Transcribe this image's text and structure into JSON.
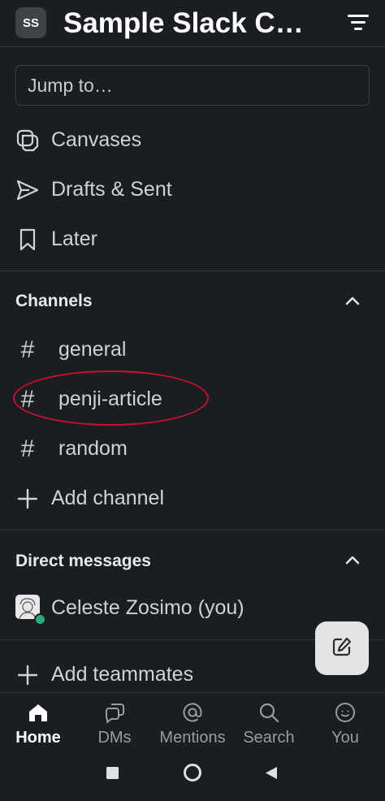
{
  "header": {
    "workspace_initials": "SS",
    "workspace_name": "Sample Slack C…"
  },
  "jump": {
    "placeholder": "Jump to…"
  },
  "shortcuts": [
    {
      "label": "Canvases",
      "icon": "canvases-icon"
    },
    {
      "label": "Drafts & Sent",
      "icon": "send-icon"
    },
    {
      "label": "Later",
      "icon": "bookmark-icon"
    }
  ],
  "channels": {
    "title": "Channels",
    "items": [
      {
        "name": "general"
      },
      {
        "name": "penji-article"
      },
      {
        "name": "random"
      }
    ],
    "add_label": "Add channel"
  },
  "direct_messages": {
    "title": "Direct messages",
    "items": [
      {
        "name": "Celeste Zosimo (you)",
        "status": "online"
      }
    ]
  },
  "add_teammates_label": "Add teammates",
  "tabs": [
    {
      "label": "Home",
      "icon": "home-icon",
      "active": true
    },
    {
      "label": "DMs",
      "icon": "dms-icon",
      "active": false
    },
    {
      "label": "Mentions",
      "icon": "at-icon",
      "active": false
    },
    {
      "label": "Search",
      "icon": "search-icon",
      "active": false
    },
    {
      "label": "You",
      "icon": "you-icon",
      "active": false
    }
  ],
  "colors": {
    "background": "#1a1d21",
    "highlight_oval": "#c8102e",
    "presence": "#2bac76"
  }
}
